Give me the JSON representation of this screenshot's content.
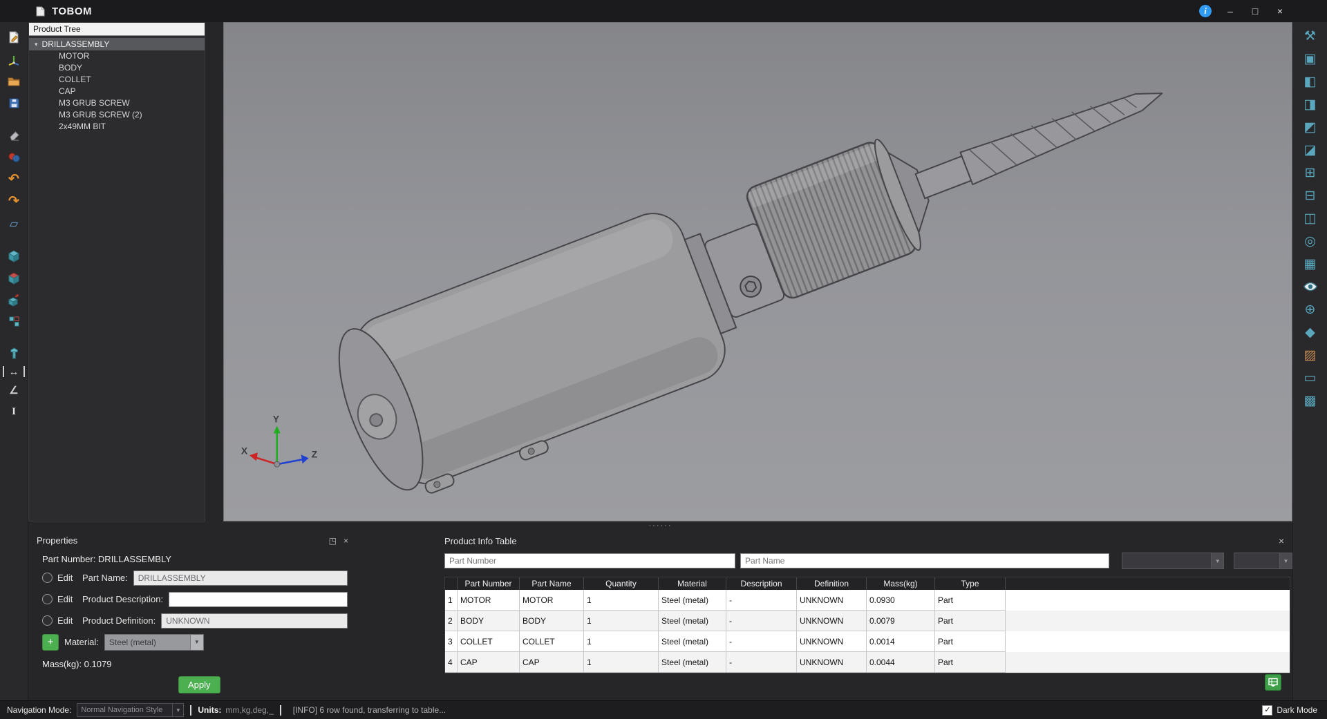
{
  "colors": {
    "accent_green": "#4caf50",
    "info_blue": "#2e9af3",
    "icon_teal": "#5aa7bd",
    "selection_gray": "#56585c"
  },
  "window": {
    "title": "TOBOM"
  },
  "title_bar_controls": {
    "info": "i",
    "minimize": "–",
    "maximize": "□",
    "close": "×"
  },
  "left_toolbar": {
    "icons": [
      {
        "name": "new-sketch"
      },
      {
        "name": "import-model"
      },
      {
        "name": "open-file"
      },
      {
        "name": "save-file"
      },
      {
        "name": "erase"
      },
      {
        "name": "material-paint"
      },
      {
        "name": "undo",
        "glyph": "↶"
      },
      {
        "name": "redo",
        "glyph": "↷"
      },
      {
        "name": "reference-plane",
        "glyph": "▱"
      },
      {
        "name": "extrude"
      },
      {
        "name": "revolve-cut"
      },
      {
        "name": "move-body"
      },
      {
        "name": "pattern"
      },
      {
        "name": "fastener"
      },
      {
        "name": "measure-length",
        "glyph": "↔"
      },
      {
        "name": "measure-angle",
        "glyph": "∠"
      },
      {
        "name": "text-annotation",
        "glyph": "I"
      }
    ]
  },
  "right_toolbar": {
    "icons": [
      {
        "name": "tools",
        "glyph": "⚒"
      },
      {
        "name": "fit-view",
        "glyph": "▣"
      },
      {
        "name": "view-front",
        "glyph": "◧"
      },
      {
        "name": "view-back",
        "glyph": "◨"
      },
      {
        "name": "view-left",
        "glyph": "◩"
      },
      {
        "name": "view-right",
        "glyph": "◪"
      },
      {
        "name": "view-top",
        "glyph": "⊞"
      },
      {
        "name": "view-bottom",
        "glyph": "⊟"
      },
      {
        "name": "view-iso",
        "glyph": "◫"
      },
      {
        "name": "zoom-window",
        "glyph": "◎"
      },
      {
        "name": "wireframe",
        "glyph": "▦"
      },
      {
        "name": "visibility"
      },
      {
        "name": "coordinate-system",
        "glyph": "⊕"
      },
      {
        "name": "move-view",
        "glyph": "◆"
      },
      {
        "name": "render",
        "glyph": "▨"
      },
      {
        "name": "display-settings",
        "glyph": "▭"
      },
      {
        "name": "section-view",
        "glyph": "▩"
      }
    ]
  },
  "product_tree": {
    "header": "Product Tree",
    "expander": "▾",
    "root": "DRILLASSEMBLY",
    "children": [
      "MOTOR",
      "BODY",
      "COLLET",
      "CAP",
      "M3 GRUB SCREW",
      "M3 GRUB SCREW (2)",
      "2x49MM BIT"
    ]
  },
  "viewport": {
    "axis_labels": {
      "x": "X",
      "y": "Y",
      "z": "Z"
    }
  },
  "splitter_dots": "······",
  "properties": {
    "title": "Properties",
    "float_glyph": "◳",
    "close_glyph": "×",
    "part_number_line": "Part Number: DRILLASSEMBLY",
    "edit_label": "Edit",
    "part_name_label": "Part Name:",
    "part_name_value": "DRILLASSEMBLY",
    "product_description_label": "Product Description:",
    "product_description_value": "",
    "product_definition_label": "Product Definition:",
    "product_definition_value": "UNKNOWN",
    "add_material_label": "+",
    "material_label": "Material:",
    "material_value": "Steel (metal)",
    "mass_line": "Mass(kg): 0.1079",
    "apply_label": "Apply"
  },
  "product_info_table": {
    "title": "Product Info Table",
    "close_glyph": "×",
    "filter_part_number_placeholder": "Part Number",
    "filter_part_name_placeholder": "Part Name",
    "columns": [
      "Part Number",
      "Part Name",
      "Quantity",
      "Material",
      "Description",
      "Definition",
      "Mass(kg)",
      "Type"
    ],
    "rows": [
      [
        "1",
        "MOTOR",
        "MOTOR",
        "1",
        "Steel (metal)",
        "-",
        "UNKNOWN",
        "0.0930",
        "Part"
      ],
      [
        "2",
        "BODY",
        "BODY",
        "1",
        "Steel (metal)",
        "-",
        "UNKNOWN",
        "0.0079",
        "Part"
      ],
      [
        "3",
        "COLLET",
        "COLLET",
        "1",
        "Steel (metal)",
        "-",
        "UNKNOWN",
        "0.0014",
        "Part"
      ],
      [
        "4",
        "CAP",
        "CAP",
        "1",
        "Steel (metal)",
        "-",
        "UNKNOWN",
        "0.0044",
        "Part"
      ]
    ]
  },
  "status_bar": {
    "navigation_mode_label": "Navigation Mode:",
    "navigation_mode_value": "Normal Navigation Style",
    "units_label": "Units:",
    "units_value": "mm,kg,deg,_",
    "info_message": "[INFO] 6 row found, transferring to table...",
    "dark_mode_label": "Dark Mode",
    "checkbox_glyph": "✓"
  }
}
